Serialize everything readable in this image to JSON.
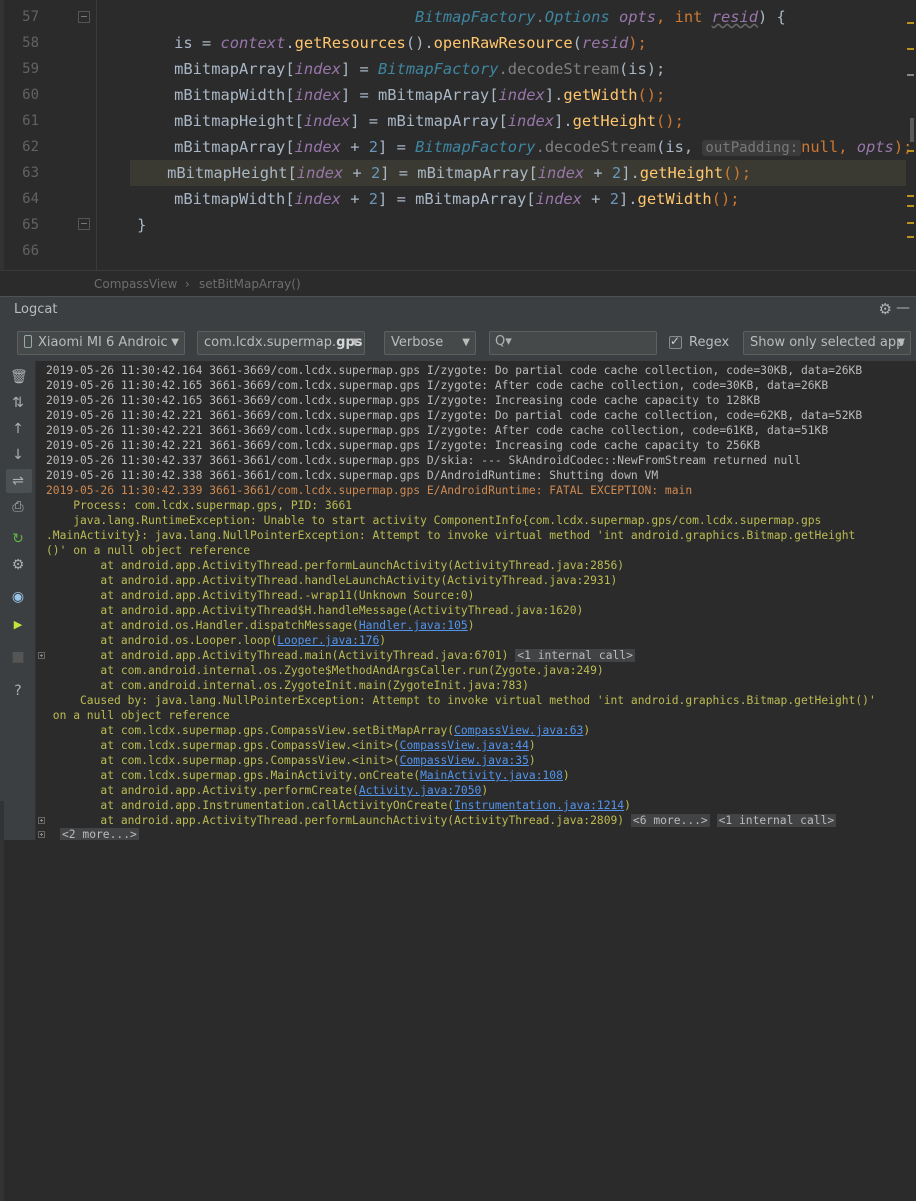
{
  "editor": {
    "line_numbers": [
      "57",
      "58",
      "59",
      "60",
      "61",
      "62",
      "63",
      "64",
      "65",
      "66"
    ],
    "lines": {
      "l57": {
        "pre": "                                  ",
        "t1": "BitmapFactory",
        "t2": ".",
        "t3": "Options",
        "t4": " ",
        "t5": "opts",
        "t6": ", ",
        "t7": "int",
        "t8": " ",
        "t9": "resid",
        "t10": ") {"
      },
      "l58": {
        "pre": "        is = ",
        "a1": "context",
        "a2": ".",
        "a3": "getResources",
        "a4": "().",
        "a5": "openRawResource",
        "a6": "(",
        "a7": "resid",
        "a8": ");"
      },
      "l59": {
        "pre": "        mBitmapArray[",
        "a1": "index",
        "a2": "] = ",
        "a3": "BitmapFactory",
        "a4": ".",
        "a5": "decodeStream",
        "a6": "(is);"
      },
      "l60": {
        "pre": "        mBitmapWidth[",
        "a1": "index",
        "a2": "] = mBitmapArray[",
        "a3": "index",
        "a4": "].",
        "a5": "getWidth",
        "a6": "();"
      },
      "l61": {
        "pre": "        mBitmapHeight[",
        "a1": "index",
        "a2": "] = mBitmapArray[",
        "a3": "index",
        "a4": "].",
        "a5": "getHeight",
        "a6": "();"
      },
      "l62": {
        "pre": "        mBitmapArray[",
        "a1": "index",
        "a2": " + ",
        "a3": "2",
        "a4": "] = ",
        "a5": "BitmapFactory",
        "a6": ".",
        "a7": "decodeStream",
        "a8": "(is, ",
        "hint": "outPadding:",
        "a9": "null",
        "a10": ", ",
        "a11": "opts",
        "a12": ");"
      },
      "l63": {
        "pre": "    mBitmapHeight[",
        "a1": "index",
        "a2": " + ",
        "a3": "2",
        "a4": "] = mBitmapArray[",
        "a5": "index",
        "a6": " + ",
        "a7": "2",
        "a8": "].",
        "a9": "getHeight",
        "a10": "();"
      },
      "l64": {
        "pre": "        mBitmapWidth[",
        "a1": "index",
        "a2": " + ",
        "a3": "2",
        "a4": "] = mBitmapArray[",
        "a5": "index",
        "a6": " + ",
        "a7": "2",
        "a8": "].",
        "a9": "getWidth",
        "a10": "();"
      },
      "l65": {
        "pre": "    }"
      }
    }
  },
  "breadcrumb": {
    "class_name": "CompassView",
    "separator": "›",
    "method_name": "setBitMapArray()"
  },
  "logcat": {
    "title": "Logcat",
    "device": "Xiaomi MI 6 Androic",
    "package_prefix": "com.lcdx.supermap.",
    "package_bold": "gps",
    "level": "Verbose",
    "search_placeholder": "",
    "search_icon_glyph": "Q▾",
    "regex_label": "Regex",
    "filter": "Show only selected app",
    "gear_glyph": "⚙",
    "minimize_glyph": "—",
    "side_icons": {
      "trash": "🗑",
      "soft_wrap": "⇅",
      "up": "↑",
      "down": "↓",
      "wrap": "⇌",
      "print": "⎙",
      "restart": "↻",
      "settings": "⚙",
      "camera": "◉",
      "record": "▶",
      "stop": "■",
      "help": "?"
    },
    "log": {
      "r1": "2019-05-26 11:30:42.164 3661-3669/com.lcdx.supermap.gps I/zygote: Do partial code cache collection, code=30KB, data=26KB",
      "r2": "2019-05-26 11:30:42.165 3661-3669/com.lcdx.supermap.gps I/zygote: After code cache collection, code=30KB, data=26KB",
      "r3": "2019-05-26 11:30:42.165 3661-3669/com.lcdx.supermap.gps I/zygote: Increasing code cache capacity to 128KB",
      "r4": "2019-05-26 11:30:42.221 3661-3669/com.lcdx.supermap.gps I/zygote: Do partial code cache collection, code=62KB, data=52KB",
      "r5": "2019-05-26 11:30:42.221 3661-3669/com.lcdx.supermap.gps I/zygote: After code cache collection, code=61KB, data=51KB",
      "r6": "2019-05-26 11:30:42.221 3661-3669/com.lcdx.supermap.gps I/zygote: Increasing code cache capacity to 256KB",
      "r7": "2019-05-26 11:30:42.337 3661-3661/com.lcdx.supermap.gps D/skia: --- SkAndroidCodec::NewFromStream returned null",
      "r8": "2019-05-26 11:30:42.338 3661-3661/com.lcdx.supermap.gps D/AndroidRuntime: Shutting down VM",
      "r9": "2019-05-26 11:30:42.339 3661-3661/com.lcdx.supermap.gps E/AndroidRuntime: FATAL EXCEPTION: main",
      "r10": "    Process: com.lcdx.supermap.gps, PID: 3661",
      "r11": "    java.lang.RuntimeException: Unable to start activity ComponentInfo{com.lcdx.supermap.gps/com.lcdx.supermap.gps",
      "r12": ".MainActivity}: java.lang.NullPointerException: Attempt to invoke virtual method 'int android.graphics.Bitmap.getHeight",
      "r13": "()' on a null object reference",
      "r14": "        at android.app.ActivityThread.performLaunchActivity(ActivityThread.java:2856)",
      "r15": "        at android.app.ActivityThread.handleLaunchActivity(ActivityThread.java:2931)",
      "r16": "        at android.app.ActivityThread.-wrap11(Unknown Source:0)",
      "r17": "        at android.app.ActivityThread$H.handleMessage(ActivityThread.java:1620)",
      "r18a": "        at android.os.Handler.dispatchMessage(",
      "r18b": "Handler.java:105",
      "r18c": ")",
      "r19a": "        at android.os.Looper.loop(",
      "r19b": "Looper.java:176",
      "r19c": ")",
      "r20a": "        at android.app.ActivityThread.main(ActivityThread.java:6701) ",
      "r20b": "<1 internal call>",
      "r21": "        at com.android.internal.os.Zygote$MethodAndArgsCaller.run(Zygote.java:249)",
      "r22": "        at com.android.internal.os.ZygoteInit.main(ZygoteInit.java:783)",
      "r23": "     Caused by: java.lang.NullPointerException: Attempt to invoke virtual method 'int android.graphics.Bitmap.getHeight()'",
      "r24": " on a null object reference",
      "r25a": "        at com.lcdx.supermap.gps.CompassView.setBitMapArray(",
      "r25b": "CompassView.java:63",
      "r25c": ")",
      "r26a": "        at com.lcdx.supermap.gps.CompassView.<init>(",
      "r26b": "CompassView.java:44",
      "r26c": ")",
      "r27a": "        at com.lcdx.supermap.gps.CompassView.<init>(",
      "r27b": "CompassView.java:35",
      "r27c": ")",
      "r28a": "        at com.lcdx.supermap.gps.MainActivity.onCreate(",
      "r28b": "MainActivity.java:108",
      "r28c": ")",
      "r29a": "        at android.app.Activity.performCreate(",
      "r29b": "Activity.java:7050",
      "r29c": ")",
      "r30a": "        at android.app.Instrumentation.callActivityOnCreate(",
      "r30b": "Instrumentation.java:1214",
      "r30c": ")",
      "r31a": "        at android.app.ActivityThread.performLaunchActivity(ActivityThread.java:2809) ",
      "r31b": "<6 more...>",
      "r31c": " ",
      "r31d": "<1 internal call>",
      "r32": "<2 more...>"
    }
  }
}
